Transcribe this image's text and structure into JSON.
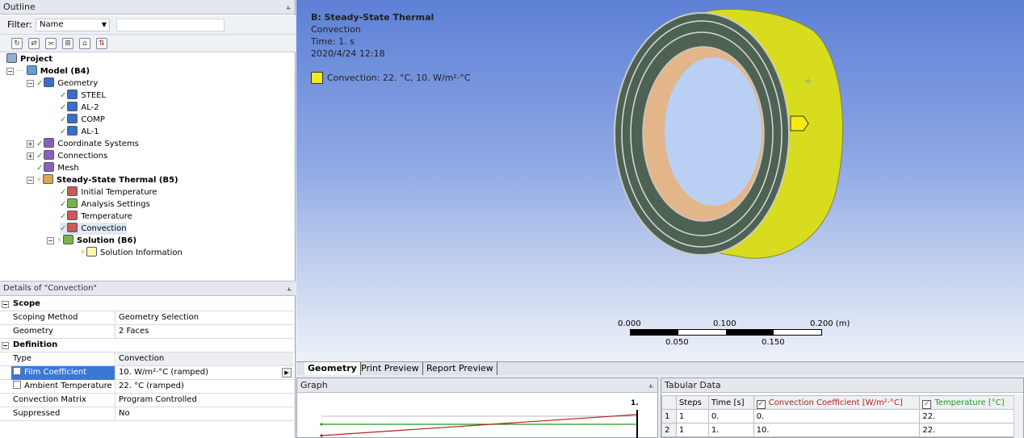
{
  "outline": {
    "title": "Outline",
    "pin": " ⊥",
    "filter_label": "Filter:",
    "filter_value": "Name",
    "search_value": ""
  },
  "tree": {
    "project": "Project",
    "model": "Model (B4)",
    "geometry": "Geometry",
    "steel": "STEEL",
    "al2": "AL-2",
    "comp": "COMP",
    "al1": "AL-1",
    "coord": "Coordinate Systems",
    "connections": "Connections",
    "mesh": "Mesh",
    "thermal": "Steady-State Thermal (B5)",
    "init_temp": "Initial Temperature",
    "analysis": "Analysis Settings",
    "temperature": "Temperature",
    "convection": "Convection",
    "solution": "Solution (B6)",
    "sol_info": "Solution Information"
  },
  "details": {
    "title": "Details of \"Convection\"",
    "scope": "Scope",
    "scoping_method_k": "Scoping Method",
    "scoping_method_v": "Geometry Selection",
    "geometry_k": "Geometry",
    "geometry_v": "2 Faces",
    "definition": "Definition",
    "type_k": "Type",
    "type_v": "Convection",
    "film_k": "Film Coefficient",
    "film_v": "10. W/m²·°C  (ramped)",
    "ambient_k": "Ambient Temperature",
    "ambient_v": "22. °C  (ramped)",
    "matrix_k": "Convection Matrix",
    "matrix_v": "Program Controlled",
    "suppressed_k": "Suppressed",
    "suppressed_v": "No"
  },
  "viewport": {
    "title": "B: Steady-State Thermal",
    "subtitle": "Convection",
    "time": "Time: 1. s",
    "date": "2020/4/24 12:18",
    "legend": "Convection: 22. °C, 10. W/m²·°C",
    "legend_color": "#f2ec1f",
    "scale_top": [
      "0.000",
      "0.100",
      "0.200 (m)"
    ],
    "scale_bottom": [
      "0.050",
      "0.150"
    ]
  },
  "tabs": [
    "Geometry",
    "Print Preview",
    "Report Preview"
  ],
  "graph": {
    "title": "Graph",
    "end_label": "1."
  },
  "tabular": {
    "title": "Tabular Data",
    "headers": [
      "Steps",
      "Time [s]",
      "Convection Coefficient [W/m²·°C]",
      "Temperature [°C]"
    ],
    "rows": [
      [
        "1",
        "1",
        "0.",
        "0.",
        "22."
      ],
      [
        "2",
        "1",
        "1.",
        "10.",
        "22."
      ]
    ]
  }
}
